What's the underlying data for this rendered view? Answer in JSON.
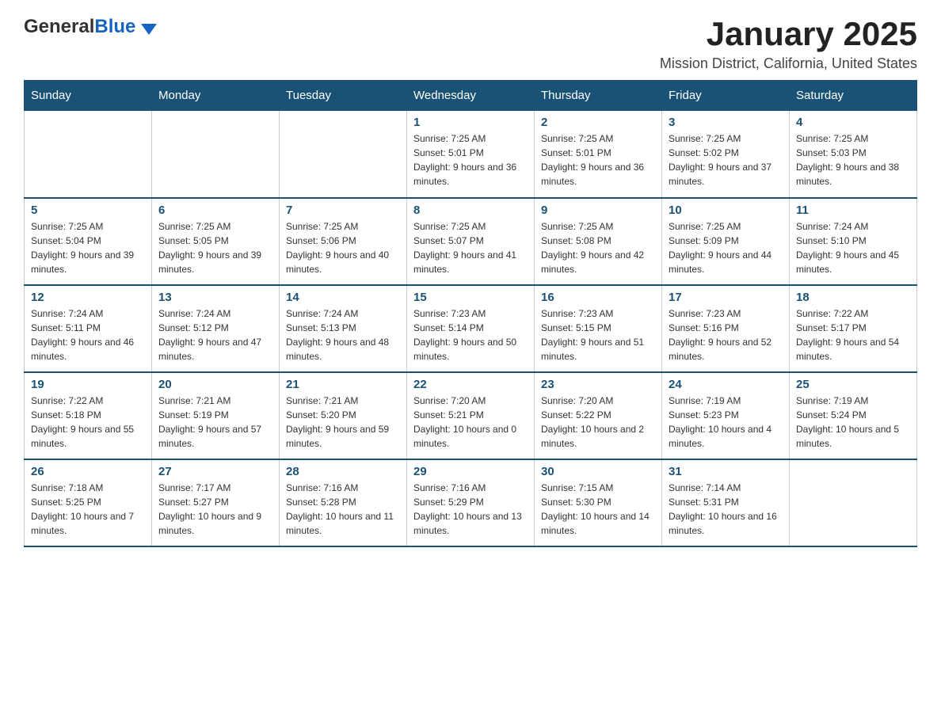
{
  "logo": {
    "general": "General",
    "blue": "Blue"
  },
  "title": "January 2025",
  "subtitle": "Mission District, California, United States",
  "days_of_week": [
    "Sunday",
    "Monday",
    "Tuesday",
    "Wednesday",
    "Thursday",
    "Friday",
    "Saturday"
  ],
  "weeks": [
    [
      {
        "day": "",
        "info": ""
      },
      {
        "day": "",
        "info": ""
      },
      {
        "day": "",
        "info": ""
      },
      {
        "day": "1",
        "info": "Sunrise: 7:25 AM\nSunset: 5:01 PM\nDaylight: 9 hours and 36 minutes."
      },
      {
        "day": "2",
        "info": "Sunrise: 7:25 AM\nSunset: 5:01 PM\nDaylight: 9 hours and 36 minutes."
      },
      {
        "day": "3",
        "info": "Sunrise: 7:25 AM\nSunset: 5:02 PM\nDaylight: 9 hours and 37 minutes."
      },
      {
        "day": "4",
        "info": "Sunrise: 7:25 AM\nSunset: 5:03 PM\nDaylight: 9 hours and 38 minutes."
      }
    ],
    [
      {
        "day": "5",
        "info": "Sunrise: 7:25 AM\nSunset: 5:04 PM\nDaylight: 9 hours and 39 minutes."
      },
      {
        "day": "6",
        "info": "Sunrise: 7:25 AM\nSunset: 5:05 PM\nDaylight: 9 hours and 39 minutes."
      },
      {
        "day": "7",
        "info": "Sunrise: 7:25 AM\nSunset: 5:06 PM\nDaylight: 9 hours and 40 minutes."
      },
      {
        "day": "8",
        "info": "Sunrise: 7:25 AM\nSunset: 5:07 PM\nDaylight: 9 hours and 41 minutes."
      },
      {
        "day": "9",
        "info": "Sunrise: 7:25 AM\nSunset: 5:08 PM\nDaylight: 9 hours and 42 minutes."
      },
      {
        "day": "10",
        "info": "Sunrise: 7:25 AM\nSunset: 5:09 PM\nDaylight: 9 hours and 44 minutes."
      },
      {
        "day": "11",
        "info": "Sunrise: 7:24 AM\nSunset: 5:10 PM\nDaylight: 9 hours and 45 minutes."
      }
    ],
    [
      {
        "day": "12",
        "info": "Sunrise: 7:24 AM\nSunset: 5:11 PM\nDaylight: 9 hours and 46 minutes."
      },
      {
        "day": "13",
        "info": "Sunrise: 7:24 AM\nSunset: 5:12 PM\nDaylight: 9 hours and 47 minutes."
      },
      {
        "day": "14",
        "info": "Sunrise: 7:24 AM\nSunset: 5:13 PM\nDaylight: 9 hours and 48 minutes."
      },
      {
        "day": "15",
        "info": "Sunrise: 7:23 AM\nSunset: 5:14 PM\nDaylight: 9 hours and 50 minutes."
      },
      {
        "day": "16",
        "info": "Sunrise: 7:23 AM\nSunset: 5:15 PM\nDaylight: 9 hours and 51 minutes."
      },
      {
        "day": "17",
        "info": "Sunrise: 7:23 AM\nSunset: 5:16 PM\nDaylight: 9 hours and 52 minutes."
      },
      {
        "day": "18",
        "info": "Sunrise: 7:22 AM\nSunset: 5:17 PM\nDaylight: 9 hours and 54 minutes."
      }
    ],
    [
      {
        "day": "19",
        "info": "Sunrise: 7:22 AM\nSunset: 5:18 PM\nDaylight: 9 hours and 55 minutes."
      },
      {
        "day": "20",
        "info": "Sunrise: 7:21 AM\nSunset: 5:19 PM\nDaylight: 9 hours and 57 minutes."
      },
      {
        "day": "21",
        "info": "Sunrise: 7:21 AM\nSunset: 5:20 PM\nDaylight: 9 hours and 59 minutes."
      },
      {
        "day": "22",
        "info": "Sunrise: 7:20 AM\nSunset: 5:21 PM\nDaylight: 10 hours and 0 minutes."
      },
      {
        "day": "23",
        "info": "Sunrise: 7:20 AM\nSunset: 5:22 PM\nDaylight: 10 hours and 2 minutes."
      },
      {
        "day": "24",
        "info": "Sunrise: 7:19 AM\nSunset: 5:23 PM\nDaylight: 10 hours and 4 minutes."
      },
      {
        "day": "25",
        "info": "Sunrise: 7:19 AM\nSunset: 5:24 PM\nDaylight: 10 hours and 5 minutes."
      }
    ],
    [
      {
        "day": "26",
        "info": "Sunrise: 7:18 AM\nSunset: 5:25 PM\nDaylight: 10 hours and 7 minutes."
      },
      {
        "day": "27",
        "info": "Sunrise: 7:17 AM\nSunset: 5:27 PM\nDaylight: 10 hours and 9 minutes."
      },
      {
        "day": "28",
        "info": "Sunrise: 7:16 AM\nSunset: 5:28 PM\nDaylight: 10 hours and 11 minutes."
      },
      {
        "day": "29",
        "info": "Sunrise: 7:16 AM\nSunset: 5:29 PM\nDaylight: 10 hours and 13 minutes."
      },
      {
        "day": "30",
        "info": "Sunrise: 7:15 AM\nSunset: 5:30 PM\nDaylight: 10 hours and 14 minutes."
      },
      {
        "day": "31",
        "info": "Sunrise: 7:14 AM\nSunset: 5:31 PM\nDaylight: 10 hours and 16 minutes."
      },
      {
        "day": "",
        "info": ""
      }
    ]
  ]
}
